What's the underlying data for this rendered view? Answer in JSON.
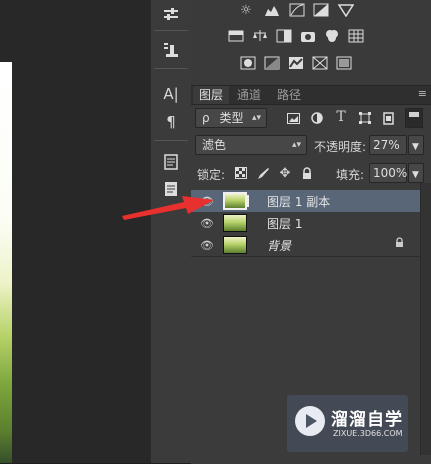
{
  "tool_strip": {
    "tools": [
      {
        "icon": "channel-mixer-icon"
      },
      {
        "icon": "clone-source-icon"
      },
      {
        "icon": "character-icon",
        "glyph": "A|"
      },
      {
        "icon": "paragraph-icon",
        "glyph": "¶"
      },
      {
        "icon": "notes-icon"
      },
      {
        "icon": "paragraph-styles-icon"
      }
    ]
  },
  "adjustments": {
    "row1": [
      "brightness-icon",
      "levels-icon",
      "curves-icon",
      "exposure-icon",
      "vibrance-icon"
    ],
    "row2": [
      "hue-saturation-icon",
      "color-balance-icon",
      "black-white-icon",
      "photo-filter-icon",
      "channel-mixer-adj-icon",
      "color-lookup-icon"
    ],
    "row3": [
      "invert-icon",
      "posterize-icon",
      "threshold-icon",
      "selective-color-icon",
      "gradient-map-icon"
    ]
  },
  "layers_panel": {
    "tabs": [
      {
        "label": "图层",
        "active": true
      },
      {
        "label": "通道",
        "active": false
      },
      {
        "label": "路径",
        "active": false
      }
    ],
    "menu_glyph": "≡",
    "filter": {
      "search_glyph": "ρ",
      "kind_label": "类型"
    },
    "blend_mode": "滤色",
    "opacity_label": "不透明度:",
    "opacity_value": "27%",
    "lock_label": "锁定:",
    "fill_label": "填充:",
    "fill_value": "100%",
    "layers": [
      {
        "name": "图层 1 副本",
        "selected": true,
        "visible": true,
        "locked": false
      },
      {
        "name": "图层 1",
        "selected": false,
        "visible": true,
        "locked": false
      },
      {
        "name": "背景",
        "selected": false,
        "visible": true,
        "locked": true
      }
    ]
  },
  "watermark": {
    "title": "溜溜自学",
    "url": "ZIXUE.3D66.COM"
  },
  "colors": {
    "selected_row": "#596678",
    "arrow": "#e8302e"
  }
}
